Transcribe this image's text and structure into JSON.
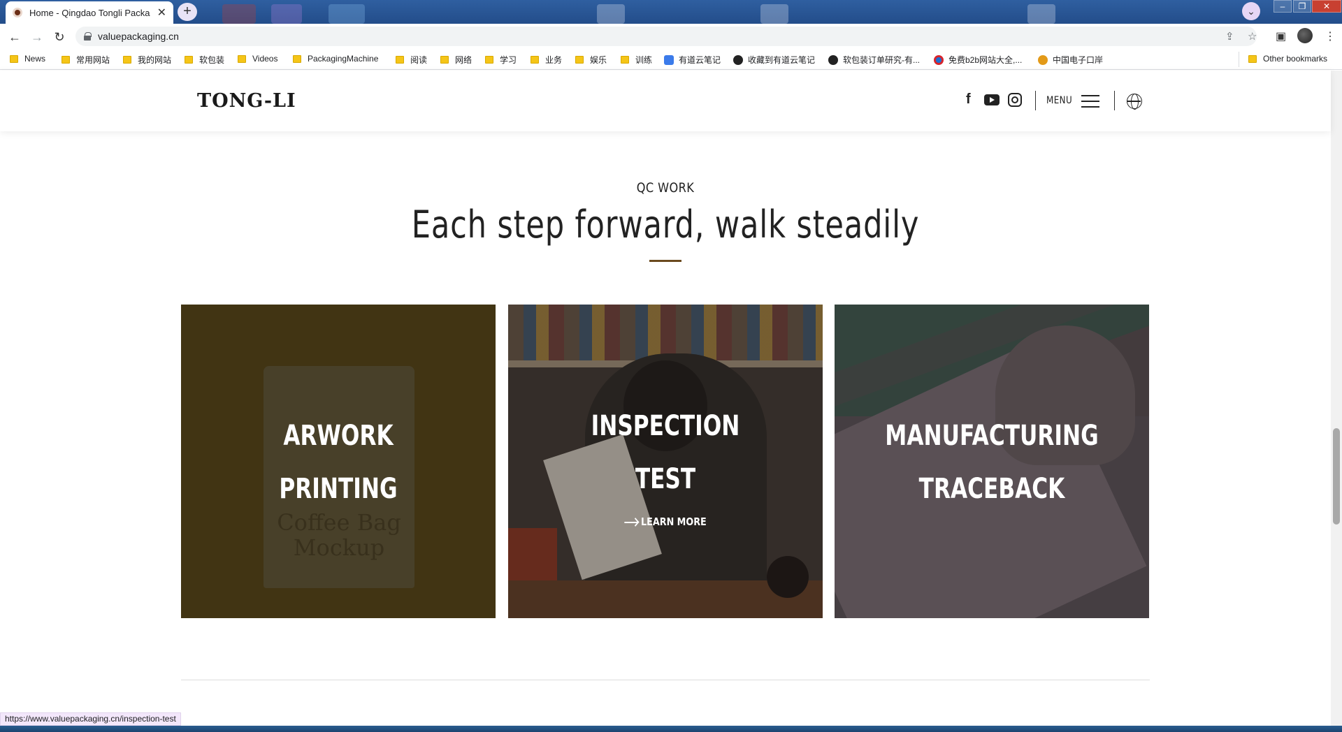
{
  "browser": {
    "tab_title": "Home - Qingdao Tongli Packa",
    "url": "valuepackaging.cn",
    "status_url": "https://www.valuepackaging.cn/inspection-test",
    "bookmarks": [
      {
        "label": "News",
        "icon": "folder-icon"
      },
      {
        "label": "常用网站",
        "icon": "folder-icon"
      },
      {
        "label": "我的网站",
        "icon": "folder-icon"
      },
      {
        "label": "软包装",
        "icon": "folder-icon"
      },
      {
        "label": "Videos",
        "icon": "folder-icon"
      },
      {
        "label": "PackagingMachine",
        "icon": "folder-icon"
      },
      {
        "label": "阅读",
        "icon": "folder-icon"
      },
      {
        "label": "网络",
        "icon": "folder-icon"
      },
      {
        "label": "学习",
        "icon": "folder-icon"
      },
      {
        "label": "业务",
        "icon": "folder-icon"
      },
      {
        "label": "娱乐",
        "icon": "folder-icon"
      },
      {
        "label": "训练",
        "icon": "folder-icon"
      },
      {
        "label": "有道云笔记",
        "icon": "youdao-icon"
      },
      {
        "label": "收藏到有道云笔记",
        "icon": "bookmark-site-icon"
      },
      {
        "label": "软包装订单研究-有...",
        "icon": "bookmark-site-icon"
      },
      {
        "label": "免费b2b网站大全,...",
        "icon": "b2b-site-icon"
      },
      {
        "label": "中国电子口岸",
        "icon": "port-site-icon"
      }
    ],
    "other_bookmarks": "Other bookmarks"
  },
  "site": {
    "logo": "TONG-LI",
    "menu_label": "MENU",
    "social": [
      "facebook-icon",
      "youtube-icon",
      "instagram-icon"
    ]
  },
  "section": {
    "eyebrow": "QC WORK",
    "headline": "Each step forward, walk steadily",
    "accent_color": "#6b4a1f",
    "cards": [
      {
        "line1": "ARWORK",
        "line2": "PRINTING"
      },
      {
        "line1": "INSPECTION",
        "line2": "TEST",
        "cta": "LEARN MORE"
      },
      {
        "line1": "MANUFACTURING",
        "line2": "TRACEBACK"
      }
    ],
    "bag_print": "Coffee Bag Mockup"
  }
}
